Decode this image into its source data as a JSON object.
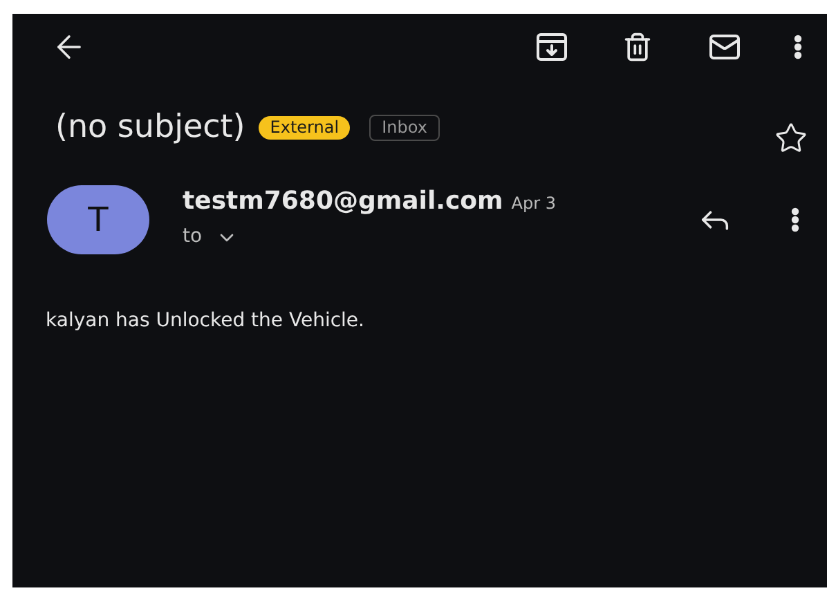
{
  "message": {
    "subject": "(no subject)",
    "labels": [
      {
        "text": "External",
        "kind": "highlight"
      },
      {
        "text": "Inbox",
        "kind": "outline"
      }
    ],
    "starred": false,
    "sender": {
      "initial": "T",
      "email": "testm7680@gmail.com",
      "date": "Apr 3",
      "to": "to"
    },
    "body": "kalyan has Unlocked the Vehicle."
  }
}
